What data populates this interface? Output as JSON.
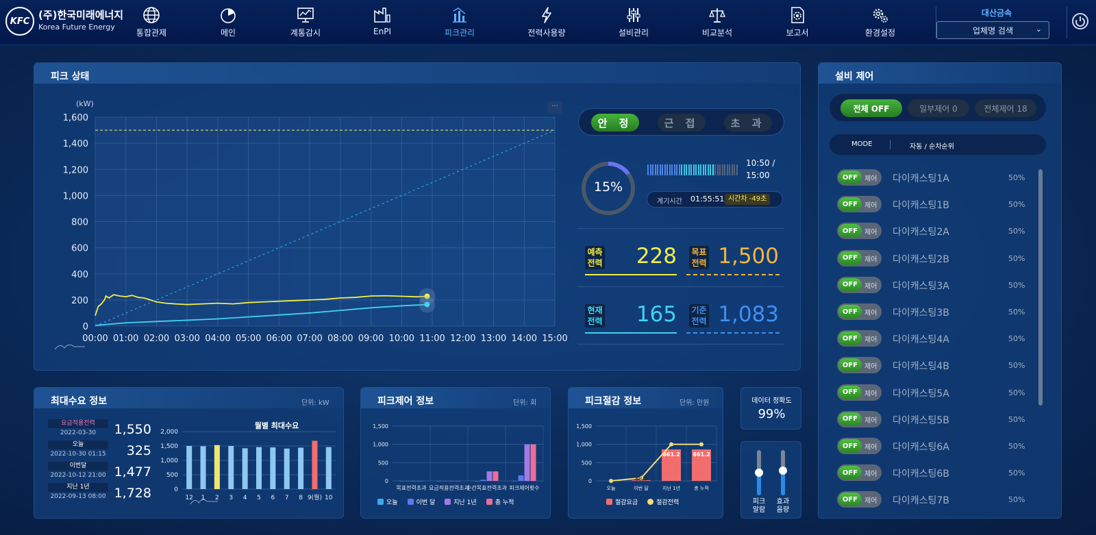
{
  "header": {
    "logo_mark": "KFC",
    "logo_kr": "(주)한국미래에너지",
    "logo_en": "Korea Future Energy",
    "nav": [
      {
        "label": "통합관제",
        "icon": "globe-icon"
      },
      {
        "label": "메인",
        "icon": "pie-chart-icon"
      },
      {
        "label": "계통감시",
        "icon": "monitor-icon"
      },
      {
        "label": "EnPI",
        "icon": "factory-icon"
      },
      {
        "label": "피크관리",
        "icon": "peak-chart-icon",
        "active": true
      },
      {
        "label": "전력사용량",
        "icon": "lightning-icon"
      },
      {
        "label": "설비관리",
        "icon": "equalizer-icon"
      },
      {
        "label": "비교분석",
        "icon": "scale-icon"
      },
      {
        "label": "보고서",
        "icon": "report-icon"
      },
      {
        "label": "환경설정",
        "icon": "gears-icon"
      }
    ],
    "company": "대산금속",
    "company_search": "업체명 검색"
  },
  "peak": {
    "title": "피크 상태",
    "status": [
      "안 정",
      "근 접",
      "초 과"
    ],
    "active_status_index": 0,
    "progress_pct": "15%",
    "progress_value": 15,
    "progress_bar_fill": 0.73,
    "time_label": "10:50 /",
    "time_total": "15:00",
    "meter_label": "계기시간",
    "meter_time": "01:55:51",
    "time_diff": "시간차 -49초",
    "forecast_label1": "예측",
    "forecast_label2": "전력",
    "forecast_value": "228",
    "target_label1": "목표",
    "target_label2": "전력",
    "target_value": "1,500",
    "current_label1": "현재",
    "current_label2": "전력",
    "current_value": "165",
    "base_label1": "기준",
    "base_label2": "전력",
    "base_value": "1,083",
    "menu": "···"
  },
  "chart_data": [
    {
      "type": "line",
      "ylabel": "(kW)",
      "ylim": [
        0,
        1600
      ],
      "yticks": [
        "0",
        "200",
        "400",
        "600",
        "800",
        "1,000",
        "1,200",
        "1,400",
        "1,600"
      ],
      "xticks": [
        "00:00",
        "01:00",
        "02:00",
        "03:00",
        "04:00",
        "05:00",
        "06:00",
        "07:00",
        "08:00",
        "09:00",
        "10:00",
        "11:00",
        "12:00",
        "13:00",
        "14:00",
        "15:00"
      ],
      "xlim": [
        0,
        15
      ],
      "target": 1500,
      "series": [
        {
          "color": "#f2ee4a",
          "x": [
            0,
            0.1,
            0.2,
            0.3,
            0.35,
            0.45,
            0.6,
            0.8,
            1.0,
            1.2,
            1.4,
            1.6,
            1.8,
            2.0,
            2.3,
            2.6,
            3.0,
            3.5,
            4.0,
            4.5,
            5.0,
            5.5,
            6.0,
            6.5,
            7.0,
            7.5,
            8.0,
            8.5,
            9.0,
            9.5,
            10.0,
            10.5,
            10.83
          ],
          "y": [
            80,
            150,
            170,
            200,
            230,
            215,
            240,
            230,
            225,
            235,
            220,
            215,
            200,
            185,
            175,
            170,
            165,
            170,
            175,
            170,
            180,
            185,
            190,
            195,
            200,
            205,
            215,
            220,
            230,
            232,
            228,
            224,
            228
          ]
        },
        {
          "color": "#3fd4f2",
          "x": [
            0,
            0.5,
            1,
            2,
            3,
            4,
            5,
            6,
            7,
            8,
            9,
            10,
            10.83
          ],
          "y": [
            5,
            15,
            25,
            35,
            45,
            55,
            70,
            85,
            100,
            120,
            140,
            155,
            165
          ]
        },
        {
          "color": "#2fa2e6",
          "style": "dotted",
          "x": [
            0,
            15
          ],
          "y": [
            0,
            1500
          ]
        }
      ]
    },
    {
      "type": "bar",
      "title": "월별 최대수요",
      "categories": [
        "12",
        "1",
        "2",
        "3",
        "4",
        "5",
        "6",
        "7",
        "8",
        "9(월)",
        "10"
      ],
      "values": [
        1500,
        1490,
        1530,
        1500,
        1420,
        1460,
        1450,
        1410,
        1440,
        1680,
        1460
      ],
      "highlight": {
        "2": "#f2e66c",
        "9(월)": "#f26d6d"
      },
      "ylim": [
        0,
        2000
      ],
      "yticks": [
        "0",
        "500",
        "1,000",
        "1,500",
        "2,000"
      ]
    },
    {
      "type": "bar",
      "categories": [
        "목표전력초과",
        "요금적용전력초과",
        "순간목표전력초과",
        "피크제어횟수"
      ],
      "series": [
        {
          "name": "오늘",
          "color": "#3fa6ea",
          "values": [
            0,
            0,
            0,
            0
          ]
        },
        {
          "name": "이번 달",
          "color": "#5f78e8",
          "values": [
            0,
            0,
            30,
            150
          ]
        },
        {
          "name": "지난 1년",
          "color": "#a07be8",
          "values": [
            0,
            0,
            260,
            1000
          ]
        },
        {
          "name": "총 누적",
          "color": "#ef6b98",
          "values": [
            0,
            0,
            260,
            1000
          ]
        }
      ],
      "ylim": [
        0,
        1500
      ],
      "yticks": [
        "0",
        "500",
        "1,000",
        "1,500"
      ]
    },
    {
      "type": "bar",
      "categories": [
        "오늘",
        "이번 달",
        "지난 1년",
        "총 누적"
      ],
      "series": [
        {
          "name": "절감요금",
          "color": "#f26d6d",
          "values": [
            0,
            20,
            861.2,
            861.2
          ],
          "labels": [
            "",
            "",
            "861.2",
            "861.2"
          ]
        },
        {
          "name": "절감전력",
          "color": "#f2dd78",
          "type": "line",
          "values": [
            0,
            80,
            1000,
            1000
          ],
          "labels": [
            "",
            "88.9",
            "",
            ""
          ]
        }
      ],
      "ylim": [
        0,
        1500
      ],
      "yticks": [
        "0",
        "500",
        "1,000",
        "1,500"
      ]
    }
  ],
  "demand": {
    "title": "최대수요 정보",
    "unit": "단위: kW",
    "stats": [
      {
        "label": "요금적용전력",
        "date": "2022-03-30",
        "value": "1,550",
        "color": "#f277c8"
      },
      {
        "label": "오늘",
        "date": "2022-10-30 01:15",
        "value": "325",
        "color": "#ffffff"
      },
      {
        "label": "이번달",
        "date": "2022-10-12 21:00",
        "value": "1,477",
        "color": "#ffffff"
      },
      {
        "label": "지난 1년",
        "date": "2022-09-13 08:00",
        "value": "1,728",
        "color": "#ffffff"
      }
    ]
  },
  "peakctl": {
    "title": "피크제어 정보",
    "unit": "단위: 회"
  },
  "peakcut": {
    "title": "피크절감 정보",
    "unit": "단위: 만원"
  },
  "accuracy": {
    "label": "데이터 정확도",
    "value": "99%"
  },
  "sliders": {
    "peak_label1": "피크",
    "peak_label2": "알람",
    "eff_label1": "효과",
    "eff_label2": "음량",
    "peak_level": 0.5,
    "eff_level": 0.55
  },
  "equip": {
    "title": "설비 제어",
    "all_off": "전체 OFF",
    "partial": "일부제어 0",
    "all_ctl": "전체제어 18",
    "mode_label": "MODE",
    "mode_value": "자동 / 순차순위",
    "toggle_on": "OFF",
    "toggle_label": "제어",
    "items": [
      {
        "name": "다이캐스팅1A",
        "pct": "50%"
      },
      {
        "name": "다이캐스팅1B",
        "pct": "50%"
      },
      {
        "name": "다이캐스팅2A",
        "pct": "50%"
      },
      {
        "name": "다이캐스팅2B",
        "pct": "50%"
      },
      {
        "name": "다이캐스팅3A",
        "pct": "50%"
      },
      {
        "name": "다이캐스팅3B",
        "pct": "50%"
      },
      {
        "name": "다이캐스팅4A",
        "pct": "50%"
      },
      {
        "name": "다이캐스팅4B",
        "pct": "50%"
      },
      {
        "name": "다이캐스팅5A",
        "pct": "50%"
      },
      {
        "name": "다이캐스팅5B",
        "pct": "50%"
      },
      {
        "name": "다이캐스팅6A",
        "pct": "50%"
      },
      {
        "name": "다이캐스팅6B",
        "pct": "50%"
      },
      {
        "name": "다이캐스팅7B",
        "pct": "50%"
      }
    ]
  }
}
